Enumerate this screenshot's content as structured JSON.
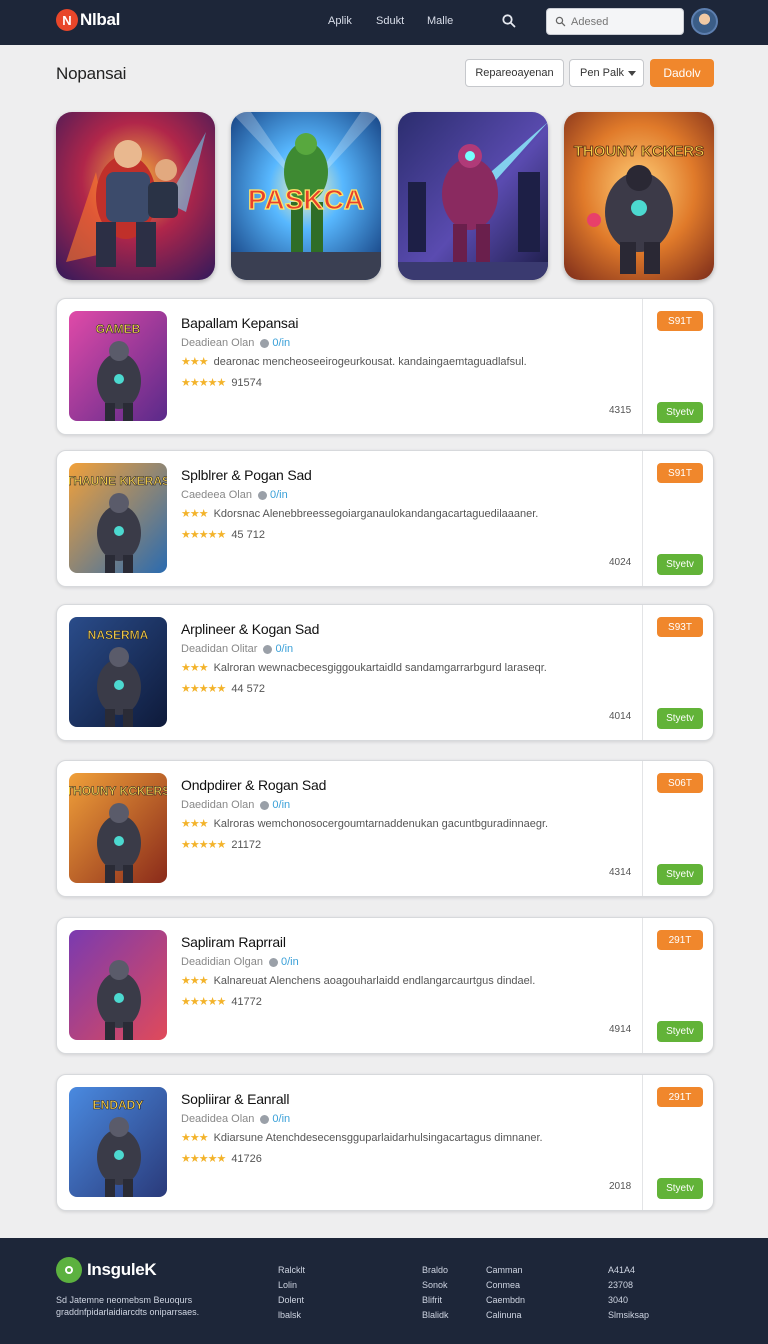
{
  "header": {
    "logo_text": "Nlbal",
    "nav": [
      "Aplik",
      "Sdukt",
      "Malle"
    ],
    "search_placeholder": "Adesed"
  },
  "toolbar": {
    "title": "Nopansai",
    "sort_label": "Repareoayenan",
    "filter_label": "Pen Palk",
    "primary_label": "Dadolv"
  },
  "featured": [
    {
      "name": "featured-hero-1",
      "label": ""
    },
    {
      "name": "featured-paskca",
      "label": "PASKCA"
    },
    {
      "name": "featured-hero-3",
      "label": ""
    },
    {
      "name": "featured-thouny-kickers",
      "label": "THOUNY KCKERS"
    }
  ],
  "apps": [
    {
      "title": "Bapallam Kepansai",
      "developer": "Deadiean Olan",
      "tag": "0/in",
      "description": "dearonac mencheoseeirogeurkousat. kandaingaemtaguadlafsul.",
      "rating": "91574",
      "size": "4315",
      "price": "S91T",
      "install": "Styetv",
      "thumb_label": "GAMEB"
    },
    {
      "title": "Splblrer & Pogan Sad",
      "developer": "Caedeea Olan",
      "tag": "0/in",
      "description": "Kdorsnac Alenebbreessegoiarganaulokandangacartaguedilaaaner.",
      "rating": "45 712",
      "size": "4024",
      "price": "S91T",
      "install": "Styetv",
      "thumb_label": "THAUNE KKERAS"
    },
    {
      "title": "Arplineer & Kogan Sad",
      "developer": "Deadidan Olitar",
      "tag": "0/in",
      "description": "Kalroran wewnacbecesgiggoukartaidld sandamgarrarbgurd laraseqr.",
      "rating": "44 572",
      "size": "4014",
      "price": "S93T",
      "install": "Styetv",
      "thumb_label": "NASERMA"
    },
    {
      "title": "Ondpdirer & Rogan Sad",
      "developer": "Daedidan Olan",
      "tag": "0/in",
      "description": "Kalroras wemchonosocergoumtarnaddenukan gacuntbguradinnaegr.",
      "rating": "21172",
      "size": "4314",
      "price": "S06T",
      "install": "Styetv",
      "thumb_label": "THOUNY KCKERS"
    },
    {
      "title": "Sapliram Raprrail",
      "developer": "Deadidian Olgan",
      "tag": "0/in",
      "description": "Kalnareuat Alenchens aoagouharlaidd endlangarcaurtgus dindael.",
      "rating": "41772",
      "size": "4914",
      "price": "291T",
      "install": "Styetv",
      "thumb_label": ""
    },
    {
      "title": "Sopliirar & Eanrall",
      "developer": "Deadidea Olan",
      "tag": "0/in",
      "description": "Kdiarsune Atenchdesecensgguparlaidarhulsingacartagus dimnaner.",
      "rating": "41726",
      "size": "2018",
      "price": "291T",
      "install": "Styetv",
      "thumb_label": "ENDADY"
    }
  ],
  "footer": {
    "brand": "InsguleK",
    "tagline": "Sd Jatemne neomebsm Beuoqurs graddnfpidarlaidiarcdts oniparrsaes.",
    "col1": [
      "Ralcklt",
      "Lolin",
      "Dolent",
      "lbalsk"
    ],
    "col2": [
      "Braldo",
      "Sonok",
      "Blifrit",
      "Blalidk"
    ],
    "col3": [
      "Camman",
      "Conmea",
      "Caembdn",
      "Calinuna"
    ],
    "col4": [
      "A41A4",
      "23708",
      "3040",
      "Slmsiksap"
    ]
  },
  "colors": {
    "topbar": "#1d2639",
    "accent_orange": "#f0872c",
    "install_green": "#62b338",
    "star": "#f3b32b",
    "link": "#3aa0d8"
  }
}
